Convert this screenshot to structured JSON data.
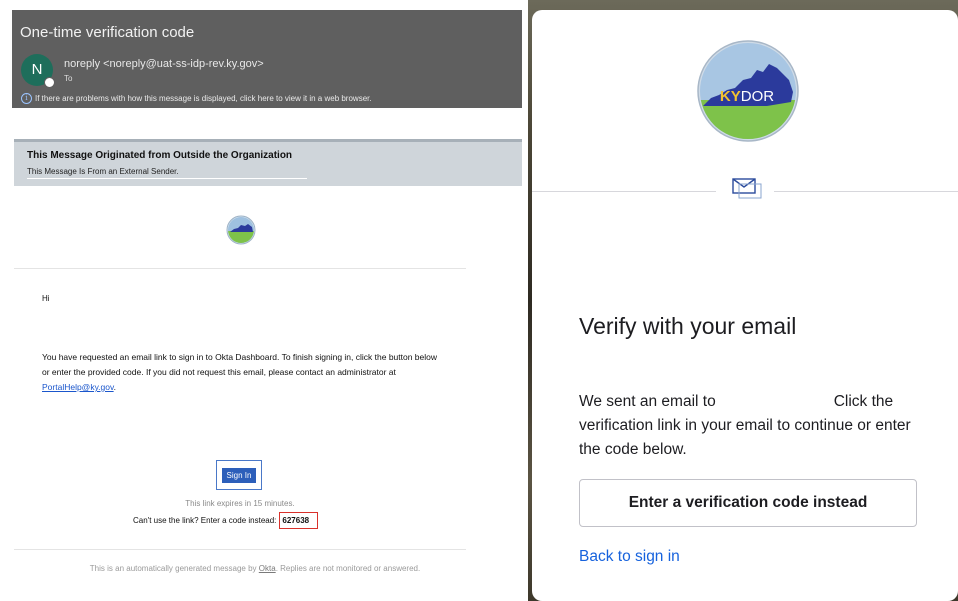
{
  "email": {
    "subject": "One-time verification code",
    "sender_initial": "N",
    "sender": "noreply <noreply@uat-ss-idp-rev.ky.gov>",
    "to_label": "To",
    "info_bar": "If there are problems with how this message is displayed, click here to view it in a web browser.",
    "banner_title": "This Message Originated from Outside the Organization",
    "banner_sub": "This Message Is From an External Sender.",
    "greeting": "Hi",
    "body_text": "You have requested an email link to sign in to Okta Dashboard. To finish signing in, click the button below or enter the provided code. If you did not request this email, please contact an administrator at",
    "help_link": "PortalHelp@ky.gov",
    "signin_label": "Sign In",
    "expires_text": "This link expires in 15 minutes.",
    "code_prompt": "Can't use the link? Enter a code instead:",
    "code": "627638",
    "footer_prefix": "This is an automatically generated message by",
    "footer_okta": "Okta",
    "footer_suffix": ". Replies are not monitored or answered."
  },
  "okta": {
    "logo_text_ky": "KY",
    "logo_text_dor": "DOR",
    "title": "Verify with your email",
    "desc_part1": "We sent an email to",
    "desc_part2": "Click the verification link in your email to continue or enter the code below.",
    "code_button": "Enter a verification code instead",
    "back_link": "Back to sign in"
  },
  "colors": {
    "email_header_bg": "#5f5f5f",
    "banner_bg": "#cfd5da",
    "signin_blue": "#2d5fba",
    "code_box_border": "#d9312b",
    "okta_link": "#1662dd",
    "logo_blue": "#2b3a9c",
    "logo_green": "#7ec24a"
  },
  "icons": [
    "info-icon",
    "kydor-logo",
    "mail-icon"
  ]
}
